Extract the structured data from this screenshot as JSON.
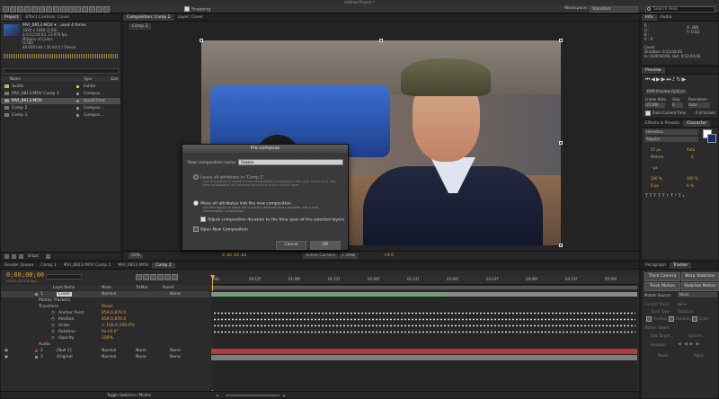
{
  "app": {
    "title": "Untitled Project *"
  },
  "toolbar": {
    "snapping": "Snapping",
    "workspace_label": "Workspace:",
    "workspace_value": "Standard",
    "search_placeholder": "Search Help"
  },
  "project": {
    "tab": "Project",
    "effect_controls_tab": "Effect Controls: Cover",
    "item_name": "MVI_0813.MOV ▾ , used 4 times",
    "item_info": [
      "1920 x 1080 (1.00)",
      "Δ 0;12;04;03, 23.976 fps",
      "Millions of Colors",
      "H.264",
      "48.000 kHz / 16 bit U / Stereo"
    ],
    "columns": {
      "name": "Name",
      "type": "Type",
      "size": "Size"
    },
    "items": [
      {
        "name": "Solids",
        "type": "Folder",
        "color": "#d8c230"
      },
      {
        "name": "MVI_0813.MOV Comp 1",
        "type": "Compos...",
        "color": "#8c8c8c"
      },
      {
        "name": "MVI_0813.MOV",
        "type": "QuickTime",
        "color": "#8c8c8c"
      },
      {
        "name": "Comp 2",
        "type": "Compos...",
        "color": "#8c8c8c"
      },
      {
        "name": "Comp 1",
        "type": "Compos...",
        "color": "#8c8c8c"
      }
    ],
    "footer": "8 bpc"
  },
  "composition": {
    "tab": "Composition: Comp 2",
    "layer_tab": "Layer: Cover",
    "subtab": "Comp 2",
    "zoom": "50%",
    "time": "0;00;00;00",
    "view": "Active Camera",
    "views": "1 View",
    "exposure": "+0.0"
  },
  "dialog": {
    "title": "Pre-compose",
    "name_label": "New composition name:",
    "name_value": "Stable",
    "opt1": "Leave all attributes in 'Comp 2'",
    "opt1_desc": "Use this option to create a new intermediate composition with only 'Cover' in it. The new composition will become the source to the current layer.",
    "opt2": "Move all attributes into the new composition",
    "opt2_desc": "Use this option to place the currently selected layers together into a new intermediate composition.",
    "chk1": "Adjust composition duration to the time span of the selected layers",
    "chk2": "Open New Composition",
    "cancel": "Cancel",
    "ok": "OK"
  },
  "info": {
    "tab": "Info",
    "audio_tab": "Audio",
    "x": "X: 398",
    "y": "Y: 1012",
    "r": "R :",
    "g": "G :",
    "b": "B :",
    "a": "A : 0",
    "layer": "Cover",
    "duration": "Duration: 0;12;04;03",
    "in_out": "In: 0;00;00;00, Out: 0;12;04;03"
  },
  "preview": {
    "tab": "Preview",
    "ram": "RAM Preview Options",
    "frame_rate": "Frame Rate",
    "skip": "Skip",
    "resolution": "Resolution",
    "fr_value": "(23.98)",
    "skip_value": "0",
    "res_value": "Auto",
    "from_current": "From Current Time",
    "full_screen": "Full Screen"
  },
  "character": {
    "effects_tab": "Effects & Presets",
    "character_tab": "Character",
    "font": "Helvetica",
    "style": "Regular",
    "size": "57 px",
    "leading": "Auto",
    "kerning": "Metrics",
    "tracking": "0",
    "stroke": "- px",
    "vscale": "100 %",
    "hscale": "100 %",
    "baseline": "0 px",
    "tsume": "0 %"
  },
  "tracker": {
    "paragraph_tab": "Paragraph",
    "tracker_tab": "Tracker",
    "track_camera": "Track Camera",
    "warp_stabilizer": "Warp Stabilizer",
    "track_motion": "Track Motion",
    "stabilize_motion": "Stabilize Motion",
    "motion_source": "Motion Source:",
    "motion_source_value": "None",
    "current_track": "Current Track:",
    "current_track_value": "None",
    "track_type": "Track Type:",
    "track_type_value": "Stabilize",
    "position": "Position",
    "rotation": "Rotation",
    "scale": "Scale",
    "motion_target": "Motion Target:",
    "edit_target": "Edit Target...",
    "options": "Options...",
    "analyze": "Analyze:",
    "reset": "Reset",
    "apply": "Apply"
  },
  "timeline": {
    "render_tab": "Render Queue",
    "tabs": [
      "Comp 1",
      "MVI_0813.MOV Comp 1",
      "MVI_0813.MOV",
      "Comp 2"
    ],
    "timecode": "0;00;00;00",
    "frames": "00000 (23.976 fps)",
    "col_layer": "Layer Name",
    "col_mode": "Mode",
    "col_trkmat": "TrkMat",
    "col_parent": "Parent",
    "ruler": [
      "00s",
      "00;12f",
      "01;00f",
      "01;12f",
      "02;00f",
      "02;12f",
      "03;00f",
      "03;12f",
      "04;00f",
      "04;12f",
      "05;00f"
    ],
    "layers": [
      {
        "num": "1",
        "name": "Cover",
        "mode": "Normal",
        "trk": "",
        "parent": "None",
        "kind": "layer"
      },
      {
        "name": "Motion Trackers",
        "kind": "group"
      },
      {
        "name": "Transform",
        "value": "Reset",
        "kind": "group"
      },
      {
        "name": "Anchor Point",
        "value": "859.0,870.0",
        "kind": "prop"
      },
      {
        "name": "Position",
        "value": "859.0,870.0",
        "kind": "prop"
      },
      {
        "name": "Scale",
        "value": "∞ 100.0,100.0%",
        "kind": "prop"
      },
      {
        "name": "Rotation",
        "value": "0x+0.0°",
        "kind": "prop"
      },
      {
        "name": "Opacity",
        "value": "100%",
        "kind": "prop2"
      },
      {
        "name": "Audio",
        "kind": "group2"
      },
      {
        "num": "2",
        "name": "[Null 2]",
        "mode": "Normal",
        "trk": "None",
        "parent": "None",
        "kind": "layer"
      },
      {
        "num": "3",
        "name": "Original",
        "mode": "Normal",
        "trk": "None",
        "parent": "None",
        "kind": "layer"
      }
    ],
    "toggle": "Toggle Switches / Modes"
  }
}
